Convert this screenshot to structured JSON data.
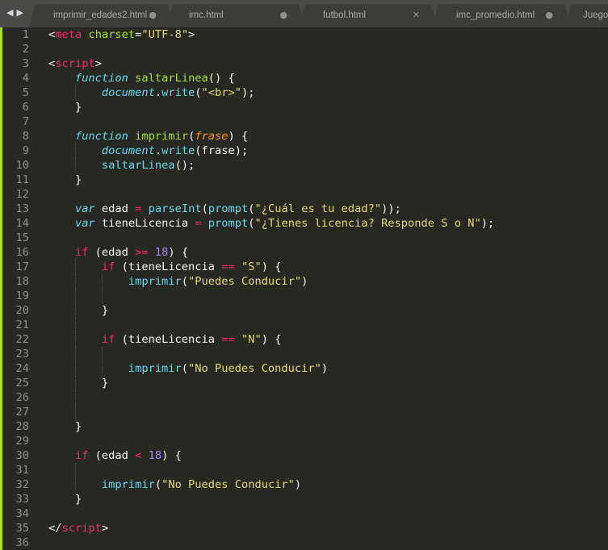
{
  "tabs": [
    {
      "label": "imprimir_edades2.html",
      "status": "●"
    },
    {
      "label": "imc.html",
      "status": "●"
    },
    {
      "label": "futbol.html",
      "status": "✕"
    },
    {
      "label": "imc_promedio.html",
      "status": "●"
    },
    {
      "label": "Juego",
      "status": ""
    }
  ],
  "nav": {
    "back": "◀",
    "forward": "▶"
  },
  "colors": {
    "background": "#272822",
    "gutter_marker": "#a6e22e",
    "keyword": "#f92672",
    "string": "#e6db74",
    "function": "#a6e22e",
    "storage": "#66d9ef",
    "number": "#ae81ff",
    "parameter": "#fd971f"
  },
  "lines": [
    {
      "i": 0,
      "t": [
        [
          "x",
          "<"
        ],
        [
          "t",
          "meta"
        ],
        [
          "x",
          " "
        ],
        [
          "a",
          "charset"
        ],
        [
          "x",
          "="
        ],
        [
          "s",
          "\"UTF-8\""
        ],
        [
          "x",
          ">"
        ]
      ]
    },
    {
      "i": 0,
      "t": []
    },
    {
      "i": 0,
      "t": [
        [
          "x",
          "<"
        ],
        [
          "t",
          "script"
        ],
        [
          "x",
          ">"
        ]
      ]
    },
    {
      "i": 1,
      "t": [
        [
          "sk",
          "function"
        ],
        [
          "x",
          " "
        ],
        [
          "f",
          "saltarLinea"
        ],
        [
          "x",
          "() {"
        ]
      ]
    },
    {
      "i": 2,
      "t": [
        [
          "di",
          "document"
        ],
        [
          "x",
          "."
        ],
        [
          "c",
          "write"
        ],
        [
          "x",
          "("
        ],
        [
          "s",
          "\"<br>\""
        ],
        [
          "x",
          ");"
        ]
      ]
    },
    {
      "i": 1,
      "t": [
        [
          "x",
          "}"
        ]
      ]
    },
    {
      "i": 0,
      "t": []
    },
    {
      "i": 1,
      "t": [
        [
          "sk",
          "function"
        ],
        [
          "x",
          " "
        ],
        [
          "f",
          "imprimir"
        ],
        [
          "x",
          "("
        ],
        [
          "p",
          "frase"
        ],
        [
          "x",
          ") {"
        ]
      ]
    },
    {
      "i": 2,
      "t": [
        [
          "di",
          "document"
        ],
        [
          "x",
          "."
        ],
        [
          "c",
          "write"
        ],
        [
          "x",
          "(frase);"
        ]
      ]
    },
    {
      "i": 2,
      "t": [
        [
          "c",
          "saltarLinea"
        ],
        [
          "x",
          "();"
        ]
      ]
    },
    {
      "i": 1,
      "t": [
        [
          "x",
          "}"
        ]
      ]
    },
    {
      "i": 0,
      "t": []
    },
    {
      "i": 1,
      "t": [
        [
          "sk",
          "var"
        ],
        [
          "x",
          " edad "
        ],
        [
          "o",
          "="
        ],
        [
          "x",
          " "
        ],
        [
          "c",
          "parseInt"
        ],
        [
          "x",
          "("
        ],
        [
          "c",
          "prompt"
        ],
        [
          "x",
          "("
        ],
        [
          "s",
          "\"¿Cuál es tu edad?\""
        ],
        [
          "x",
          "));"
        ]
      ]
    },
    {
      "i": 1,
      "t": [
        [
          "sk",
          "var"
        ],
        [
          "x",
          " tieneLicencia "
        ],
        [
          "o",
          "="
        ],
        [
          "x",
          " "
        ],
        [
          "c",
          "prompt"
        ],
        [
          "x",
          "("
        ],
        [
          "s",
          "\"¿Tienes licencia? Responde S o N\""
        ],
        [
          "x",
          ");"
        ]
      ]
    },
    {
      "i": 0,
      "t": []
    },
    {
      "i": 1,
      "t": [
        [
          "k",
          "if"
        ],
        [
          "x",
          " (edad "
        ],
        [
          "o",
          ">="
        ],
        [
          "x",
          " "
        ],
        [
          "n",
          "18"
        ],
        [
          "x",
          ") {"
        ]
      ]
    },
    {
      "i": 2,
      "t": [
        [
          "k",
          "if"
        ],
        [
          "x",
          " (tieneLicencia "
        ],
        [
          "o",
          "=="
        ],
        [
          "x",
          " "
        ],
        [
          "s",
          "\"S\""
        ],
        [
          "x",
          ") {"
        ]
      ]
    },
    {
      "i": 3,
      "t": [
        [
          "c",
          "imprimir"
        ],
        [
          "x",
          "("
        ],
        [
          "s",
          "\"Puedes Conducir\""
        ],
        [
          "x",
          ")"
        ]
      ]
    },
    {
      "i": 3,
      "t": []
    },
    {
      "i": 2,
      "t": [
        [
          "x",
          "}"
        ]
      ]
    },
    {
      "i": 2,
      "t": []
    },
    {
      "i": 2,
      "t": [
        [
          "k",
          "if"
        ],
        [
          "x",
          " (tieneLicencia "
        ],
        [
          "o",
          "=="
        ],
        [
          "x",
          " "
        ],
        [
          "s",
          "\"N\""
        ],
        [
          "x",
          ") {"
        ]
      ]
    },
    {
      "i": 3,
      "t": []
    },
    {
      "i": 3,
      "t": [
        [
          "c",
          "imprimir"
        ],
        [
          "x",
          "("
        ],
        [
          "s",
          "\"No Puedes Conducir\""
        ],
        [
          "x",
          ")"
        ]
      ]
    },
    {
      "i": 2,
      "t": [
        [
          "x",
          "}"
        ]
      ]
    },
    {
      "i": 2,
      "t": []
    },
    {
      "i": 2,
      "t": []
    },
    {
      "i": 1,
      "t": [
        [
          "x",
          "}"
        ]
      ]
    },
    {
      "i": 0,
      "t": []
    },
    {
      "i": 1,
      "t": [
        [
          "k",
          "if"
        ],
        [
          "x",
          " (edad "
        ],
        [
          "o",
          "<"
        ],
        [
          "x",
          " "
        ],
        [
          "n",
          "18"
        ],
        [
          "x",
          ") {"
        ]
      ]
    },
    {
      "i": 2,
      "t": []
    },
    {
      "i": 2,
      "t": [
        [
          "c",
          "imprimir"
        ],
        [
          "x",
          "("
        ],
        [
          "s",
          "\"No Puedes Conducir\""
        ],
        [
          "x",
          ")"
        ]
      ]
    },
    {
      "i": 1,
      "t": [
        [
          "x",
          "}"
        ]
      ]
    },
    {
      "i": 0,
      "t": []
    },
    {
      "i": 0,
      "t": [
        [
          "x",
          "</"
        ],
        [
          "t",
          "script"
        ],
        [
          "x",
          ">"
        ]
      ]
    },
    {
      "i": 0,
      "t": []
    }
  ]
}
